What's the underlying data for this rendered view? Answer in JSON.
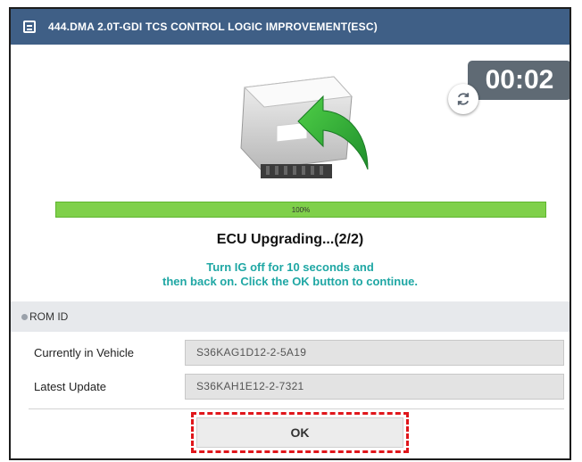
{
  "window": {
    "title": "444.DMA 2.0T-GDI TCS CONTROL LOGIC IMPROVEMENT(ESC)",
    "title_icon": "list-icon"
  },
  "timer": {
    "value": "00:02",
    "refresh_icon": "refresh-icon"
  },
  "progress": {
    "label": "100%",
    "fraction": 1.0
  },
  "status": {
    "text": "ECU Upgrading...(2/2)"
  },
  "instruction": {
    "line1": "Turn IG off for 10 seconds and",
    "line2": "then back on. Click the OK button to continue."
  },
  "rom_id": {
    "header": "ROM ID",
    "rows": [
      {
        "label": "Currently in Vehicle",
        "value": "S36KAG1D12-2-5A19"
      },
      {
        "label": "Latest Update",
        "value": "S36KAH1E12-2-7321"
      }
    ]
  },
  "ok_button": {
    "label": "OK"
  },
  "colors": {
    "titlebar": "#3f5f86",
    "progress": "#7fd04a",
    "instruction": "#1fa7a4",
    "highlight": "#e0161b"
  }
}
